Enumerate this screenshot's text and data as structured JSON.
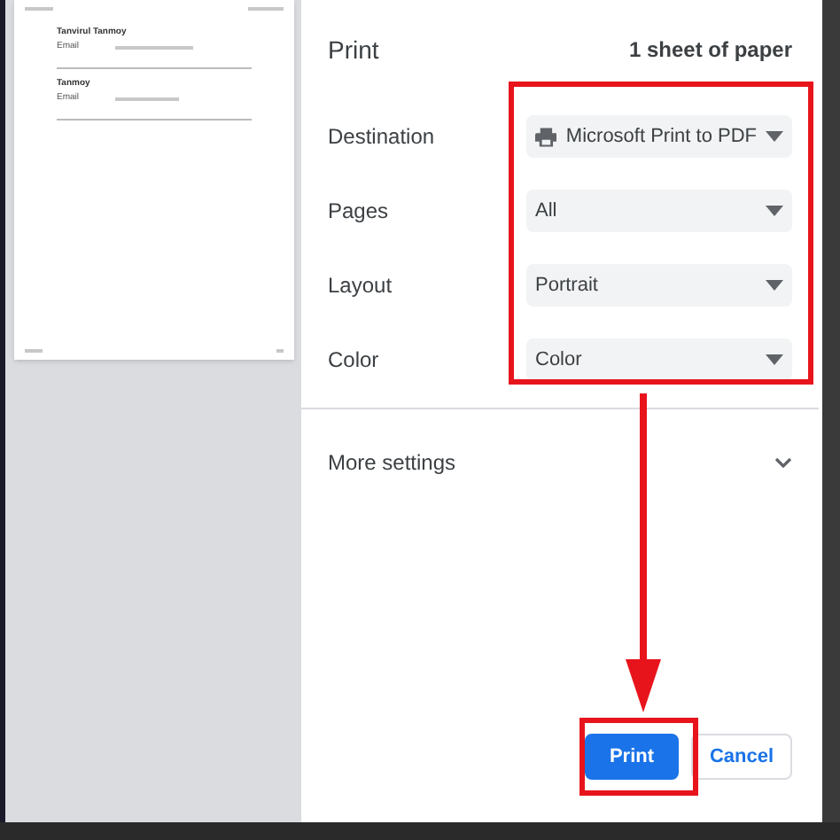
{
  "preview": {
    "name": "Tanvirul Tanmoy",
    "name_label": "Email",
    "second_name": "Tanmoy",
    "second_label": "Email"
  },
  "print_panel": {
    "title": "Print",
    "sheets": "1 sheet of paper",
    "settings": [
      {
        "label": "Destination",
        "value": "Microsoft Print to PDF",
        "kind": "printer"
      },
      {
        "label": "Pages",
        "value": "All",
        "kind": "plain"
      },
      {
        "label": "Layout",
        "value": "Portrait",
        "kind": "plain"
      },
      {
        "label": "Color",
        "value": "Color",
        "kind": "plain"
      }
    ],
    "more_settings": {
      "label": "More settings",
      "expanded": false
    },
    "buttons": [
      {
        "label": "Print",
        "kind": "primary"
      },
      {
        "label": "Cancel",
        "kind": "secondary"
      }
    ]
  }
}
